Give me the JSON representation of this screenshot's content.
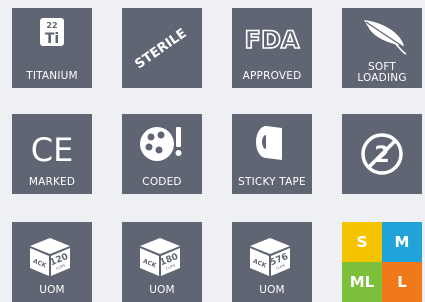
{
  "icons": {
    "titanium": {
      "label": "TITANIUM",
      "element_number": "22",
      "element_symbol": "Ti",
      "icon": "titanium-element-icon"
    },
    "sterile": {
      "label": "STERILE",
      "icon": "sterile-icon"
    },
    "fda": {
      "logo_text": "FDA",
      "label": "APPROVED",
      "icon": "fda-logo-icon"
    },
    "soft_loading": {
      "label_line1": "SOFT",
      "label_line2": "LOADING",
      "icon": "feather-icon"
    },
    "ce": {
      "logo_text": "CE",
      "label": "MARKED",
      "icon": "ce-mark-icon"
    },
    "coded": {
      "label": "CODED",
      "icon": "palette-brush-icon"
    },
    "sticky_tape": {
      "label": "STICKY TAPE",
      "icon": "tape-roll-icon"
    },
    "no_reuse": {
      "symbol": "2",
      "icon": "do-not-reuse-icon"
    },
    "uom_120": {
      "box_text": "ACK",
      "count": "120",
      "unit": "CLIPS",
      "label": "UOM",
      "icon": "box-icon"
    },
    "uom_180": {
      "box_text": "ACK",
      "count": "180",
      "unit": "CLIPS",
      "label": "UOM",
      "icon": "box-icon"
    },
    "uom_576": {
      "box_text": "ACK",
      "count": "576",
      "unit": "CLIPS",
      "label": "UOM",
      "icon": "box-icon"
    }
  },
  "sizes": {
    "cells": [
      {
        "label": "S",
        "color": "#f5c400"
      },
      {
        "label": "M",
        "color": "#1fa3d8"
      },
      {
        "label": "ML",
        "color": "#7bbf3a"
      },
      {
        "label": "L",
        "color": "#f07a1a"
      }
    ]
  },
  "colors": {
    "tile": "#5f6573",
    "background": "#eef0f3"
  }
}
